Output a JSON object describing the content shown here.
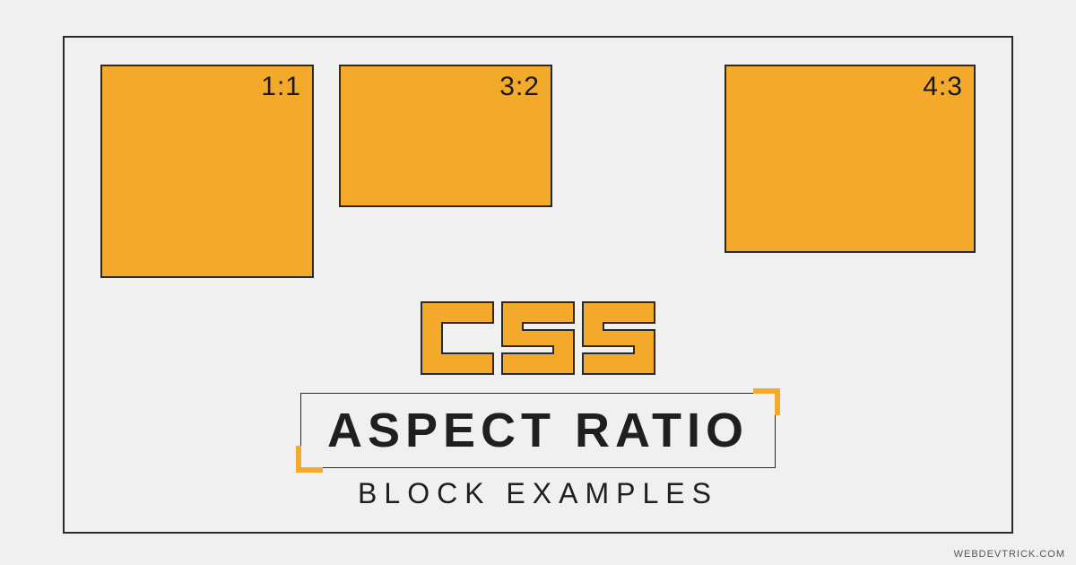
{
  "boxes": [
    {
      "label": "1:1"
    },
    {
      "label": "3:2"
    },
    {
      "label": "4:3"
    }
  ],
  "css_word": "CSS",
  "title": "ASPECT RATIO",
  "subtitle": "BLOCK EXAMPLES",
  "attribution": "WEBDEVTRICK.COM",
  "colors": {
    "accent": "#f3a929",
    "border": "#2a2a2a"
  }
}
